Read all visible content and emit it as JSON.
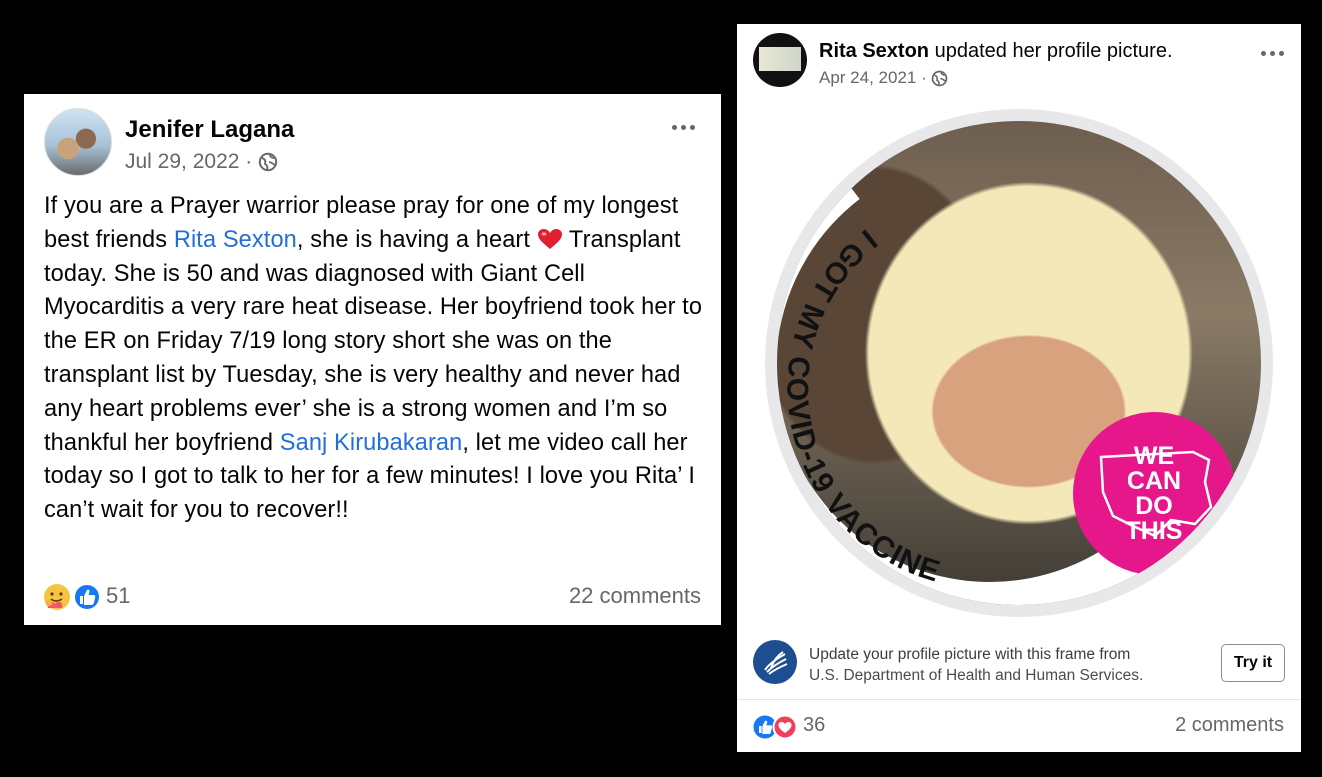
{
  "post1": {
    "author": "Jenifer Lagana",
    "date": "Jul 29, 2022",
    "date_sep": " · ",
    "body": {
      "t1": "If you are a Prayer warrior please pray for one of my longest best friends ",
      "mention1": "Rita Sexton",
      "t2": ", she is having a heart ",
      "t3": " Transplant today. She is 50 and was diagnosed with Giant Cell Myocarditis a very rare heat disease. Her boyfriend took her to the ER on Friday 7/19 long story short she was on the transplant list by Tuesday, she is very healthy and never had any heart problems ever’ she is a strong women and I’m so thankful her boyfriend ",
      "mention2": "Sanj Kirubakaran",
      "t4": ", let me video call her today so I got to talk to her for a few minutes! I love you Rita’ I can’t wait for you to recover!!"
    },
    "reaction_count": "51",
    "comments": "22 comments"
  },
  "post2": {
    "author": "Rita Sexton",
    "action": " updated her profile picture.",
    "date": "Apr 24, 2021",
    "date_sep": " · ",
    "frame_text": "I GOT MY COVID-19 VACCINE",
    "badge_lines": [
      "WE",
      "CAN",
      "DO",
      "THIS"
    ],
    "footer_line1": "Update your profile picture with this frame from",
    "footer_line2": "U.S. Department of Health and Human Services.",
    "try_label": "Try it",
    "reaction_count": "36",
    "comments": "2 comments"
  },
  "colors": {
    "link": "#216fdb",
    "badge": "#e6168b",
    "hhs_blue": "#1d4e8f",
    "meta_gray": "#65676b"
  },
  "icons": [
    "globe-icon",
    "more-options-icon",
    "heart-emoji-icon",
    "care-reaction-icon",
    "like-reaction-icon",
    "love-reaction-icon",
    "hhs-logo-icon"
  ]
}
